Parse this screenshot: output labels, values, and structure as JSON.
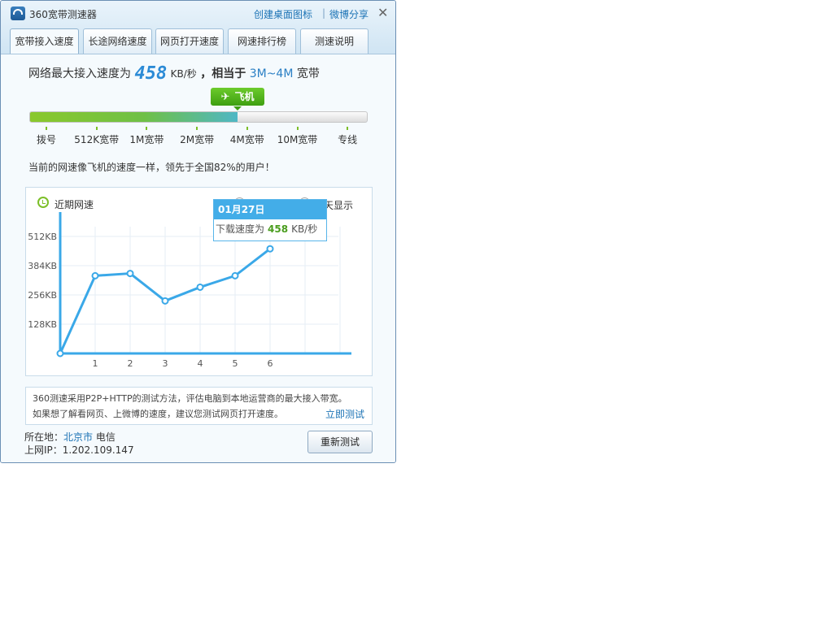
{
  "window": {
    "title": "360宽带测速器",
    "links": [
      "创建桌面图标",
      "微博分享"
    ],
    "close_glyph": "✕"
  },
  "tabs": [
    {
      "label": "宽带接入速度",
      "active": true
    },
    {
      "label": "长途网络速度",
      "active": false
    },
    {
      "label": "网页打开速度",
      "active": false
    },
    {
      "label": "网速排行榜",
      "active": false
    },
    {
      "label": "测速说明",
      "active": false
    }
  ],
  "result": {
    "prefix": "网络最大接入速度为",
    "speed": "458",
    "unit": "KB/秒",
    "middle": "，相当于",
    "bandwidth": "3M~4M",
    "suffix": "宽带"
  },
  "badge": {
    "icon": "airplane-icon",
    "label": "飞机"
  },
  "speed_scale": {
    "fill_fraction": 0.615,
    "labels": [
      "拨号",
      "512K宽带",
      "1M宽带",
      "2M宽带",
      "4M宽带",
      "10M宽带",
      "专线"
    ]
  },
  "description": "当前的网速像飞机的速度一样，领先于全国82%的用户！",
  "recent": {
    "title": "近期网速",
    "radio_label": "天显示",
    "tooltip": {
      "date": "01月27日",
      "text": "下载速度为",
      "value": "458",
      "unit": "KB/秒"
    }
  },
  "chart_data": {
    "type": "line",
    "x": [
      0,
      1,
      2,
      3,
      4,
      5,
      6
    ],
    "xticks": [
      "1",
      "2",
      "3",
      "4",
      "5",
      "6"
    ],
    "values": [
      0,
      340,
      350,
      230,
      290,
      340,
      458
    ],
    "yticks": [
      {
        "value": 128,
        "label": "128KB"
      },
      {
        "value": 256,
        "label": "256KB"
      },
      {
        "value": 384,
        "label": "384KB"
      },
      {
        "value": 512,
        "label": "512KB"
      }
    ],
    "xlim": [
      0,
      8
    ],
    "ylim": [
      0,
      512
    ],
    "grid": true,
    "color": "#3aa8e8"
  },
  "note": {
    "line1": "360测速采用P2P+HTTP的测试方法，评估电脑到本地运营商的最大接入带宽。",
    "line2": "如果想了解看网页、上微博的速度，建议您测试网页打开速度。",
    "link": "立即测试"
  },
  "location": {
    "label": "所在地：",
    "city": "北京市",
    "isp": "电信"
  },
  "ip": {
    "label": "上网IP：",
    "value": "1.202.109.147"
  },
  "retest_label": "重新测试",
  "colors": {
    "accent": "#2c8bd6",
    "green": "#4a9d1e",
    "link": "#1c73b5"
  }
}
